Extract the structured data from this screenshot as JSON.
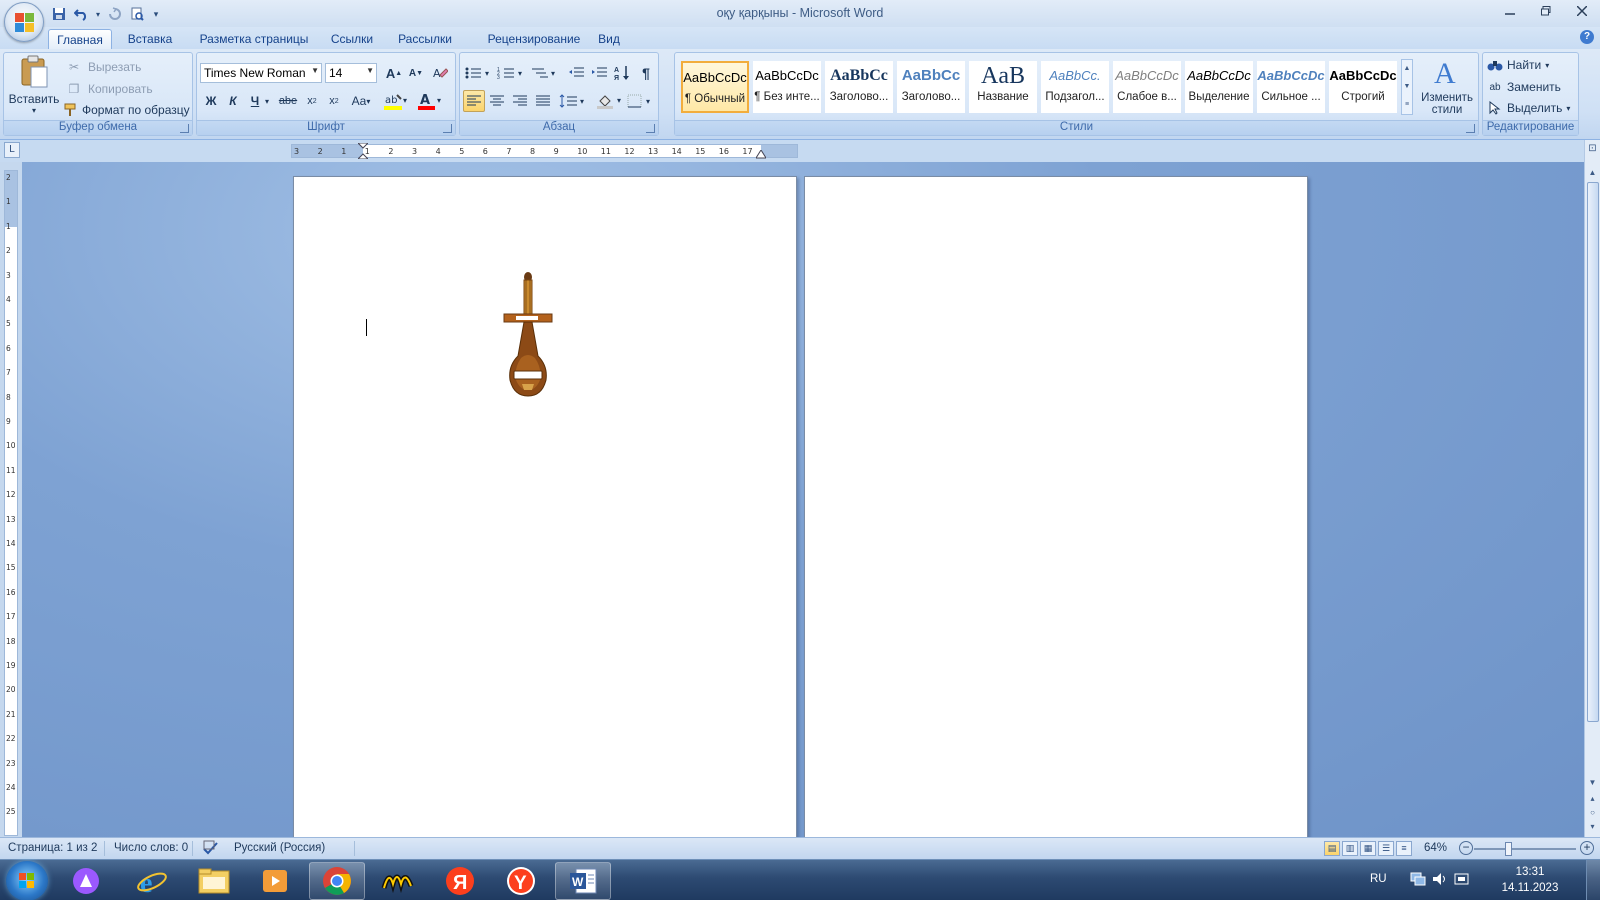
{
  "window": {
    "title": "оқу қарқыны - Microsoft Word",
    "icons": [
      "office-button-icon",
      "save-icon",
      "undo-icon",
      "redo-icon",
      "print-preview-icon",
      "customize-qat-icon",
      "minimize-icon",
      "restore-icon",
      "close-icon",
      "help-icon"
    ]
  },
  "tabs": [
    "Главная",
    "Вставка",
    "Разметка страницы",
    "Ссылки",
    "Рассылки",
    "Рецензирование",
    "Вид"
  ],
  "active_tab": "Главная",
  "clipboard": {
    "paste": "Вставить",
    "cut": "Вырезать",
    "copy": "Копировать",
    "format_painter": "Формат по образцу",
    "label": "Буфер обмена"
  },
  "font": {
    "name": "Times New Roman",
    "size": "14",
    "label": "Шрифт",
    "bold": "Ж",
    "italic": "К",
    "underline": "Ч",
    "change_case": "Aa",
    "highlight_color": "#ffff00",
    "font_color": "#ff0000"
  },
  "paragraph": {
    "label": "Абзац",
    "alignment": "left"
  },
  "styles": {
    "label": "Стили",
    "items": [
      {
        "preview": "AaBbCcDc",
        "name": "¶ Обычный"
      },
      {
        "preview": "AaBbCcDc",
        "name": "¶ Без инте..."
      },
      {
        "preview": "AaBbCc",
        "name": "Заголово..."
      },
      {
        "preview": "AaBbCc",
        "name": "Заголово..."
      },
      {
        "preview": "AaB",
        "name": "Название"
      },
      {
        "preview": "AaBbCc.",
        "name": "Подзагол..."
      },
      {
        "preview": "AaBbCcDc",
        "name": "Слабое в..."
      },
      {
        "preview": "AaBbCcDc",
        "name": "Выделение"
      },
      {
        "preview": "AaBbCcDc",
        "name": "Сильное ..."
      },
      {
        "preview": "AaBbCcDc",
        "name": "Строгий"
      }
    ],
    "change_styles_line1": "Изменить",
    "change_styles_line2": "стили"
  },
  "editing": {
    "label": "Редактирование",
    "find": "Найти",
    "replace": "Заменить",
    "select": "Выделить"
  },
  "ruler": {
    "h_ticks": [
      "3",
      "2",
      "1",
      "1",
      "2",
      "3",
      "4",
      "5",
      "6",
      "7",
      "8",
      "9",
      "10",
      "11",
      "12",
      "13",
      "14",
      "15",
      "16",
      "17"
    ],
    "v_ticks": [
      "2",
      "1",
      "1",
      "2",
      "3",
      "4",
      "5",
      "6",
      "7",
      "8",
      "9",
      "10",
      "11",
      "12",
      "13",
      "14",
      "15",
      "16",
      "17",
      "18",
      "19",
      "20",
      "21",
      "22",
      "23",
      "24",
      "25"
    ]
  },
  "status": {
    "page": "Страница: 1 из 2",
    "words": "Число слов: 0",
    "language": "Русский (Россия)",
    "zoom": "64%"
  },
  "taskbar": {
    "apps": [
      "start-button",
      "alice-app",
      "internet-explorer",
      "file-explorer",
      "media-player",
      "google-chrome",
      "yandex-market",
      "yandex",
      "yandex-browser",
      "microsoft-word"
    ],
    "language": "RU",
    "time": "13:31",
    "date": "14.11.2023"
  },
  "colors": {
    "ribbon_bg": "#cfe0f5",
    "workspace_bg": "#7ea2d3",
    "accent": "#f2ad3d",
    "taskbar": "#2d4a72"
  }
}
